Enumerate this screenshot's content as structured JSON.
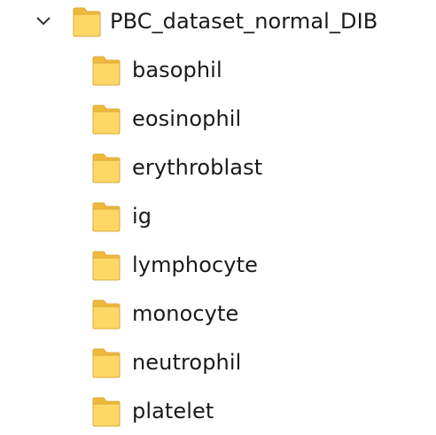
{
  "tree": {
    "root": {
      "label": "PBC_dataset_normal_DIB",
      "expanded": true,
      "icon": "folder-icon",
      "expander_icon": "chevron-down-icon"
    },
    "children": [
      {
        "label": "basophil",
        "icon": "folder-icon"
      },
      {
        "label": "eosinophil",
        "icon": "folder-icon"
      },
      {
        "label": "erythroblast",
        "icon": "folder-icon"
      },
      {
        "label": "ig",
        "icon": "folder-icon"
      },
      {
        "label": "lymphocyte",
        "icon": "folder-icon"
      },
      {
        "label": "monocyte",
        "icon": "folder-icon"
      },
      {
        "label": "neutrophil",
        "icon": "folder-icon"
      },
      {
        "label": "platelet",
        "icon": "folder-icon"
      }
    ]
  },
  "colors": {
    "folder_fill": "#ffd766",
    "folder_back": "#f0b93b",
    "folder_stroke": "#d9a93b",
    "chevron": "#333333",
    "text": "#1a1a1a"
  }
}
